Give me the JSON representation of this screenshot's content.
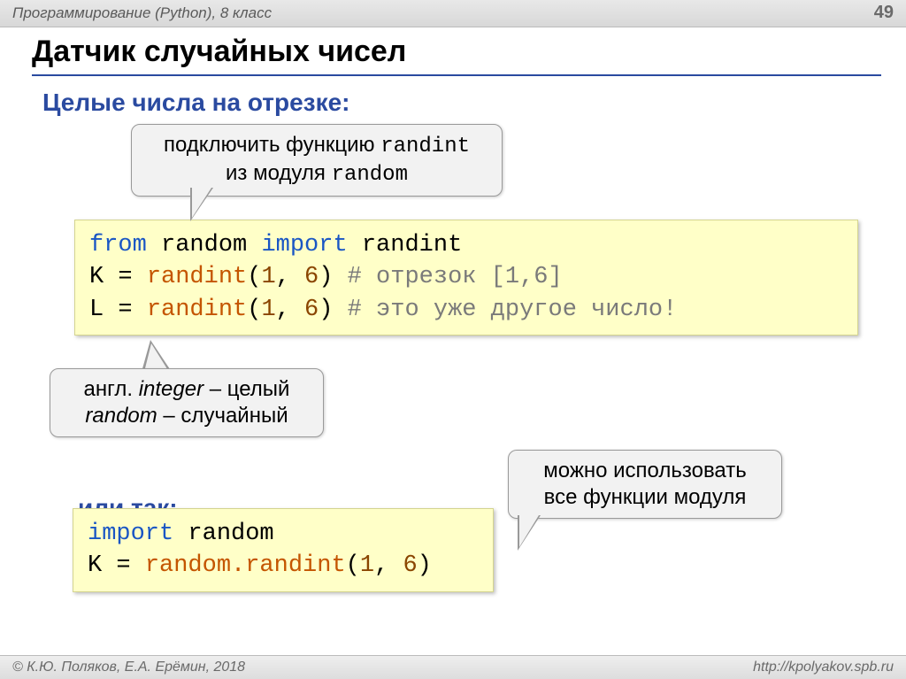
{
  "header": {
    "course": "Программирование (Python), 8 класс",
    "page": "49"
  },
  "title": "Датчик случайных чисел",
  "subtitle1": "Целые числа на отрезке:",
  "callout1": {
    "line1_pre": "подключить функцию ",
    "line1_code": "randint",
    "line2_pre": "из модуля ",
    "line2_code": "random"
  },
  "code1": {
    "l1": {
      "from": "from",
      "mod": "random",
      "import": "import",
      "name": "randint"
    },
    "l2": {
      "var": "K = ",
      "fn": "randint",
      "args_open": "(",
      "a1": "1",
      "comma": ", ",
      "a2": "6",
      "args_close": ")",
      "sp": " ",
      "comment": "# отрезок [1,6]"
    },
    "l3": {
      "var": "L = ",
      "fn": "randint",
      "args_open": "(",
      "a1": "1",
      "comma": ", ",
      "a2": "6",
      "args_close": ")",
      "sp": " ",
      "comment": "# это уже другое число!"
    }
  },
  "callout2": {
    "line1_pre": "англ. ",
    "line1_it": "integer",
    "line1_post": " – целый",
    "line2_it": "random",
    "line2_post": " – случайный"
  },
  "subtitle2": "или так:",
  "code2": {
    "l1": {
      "import": "import",
      "mod": "random"
    },
    "l2": {
      "var": "K = ",
      "obj": "random.",
      "fn": "randint",
      "args_open": "(",
      "a1": "1",
      "comma": ", ",
      "a2": "6",
      "args_close": ")"
    }
  },
  "callout3": {
    "line1": "можно использовать",
    "line2": "все функции модуля"
  },
  "footer": {
    "left": "© К.Ю. Поляков, Е.А. Ерёмин, 2018",
    "right": "http://kpolyakov.spb.ru"
  }
}
